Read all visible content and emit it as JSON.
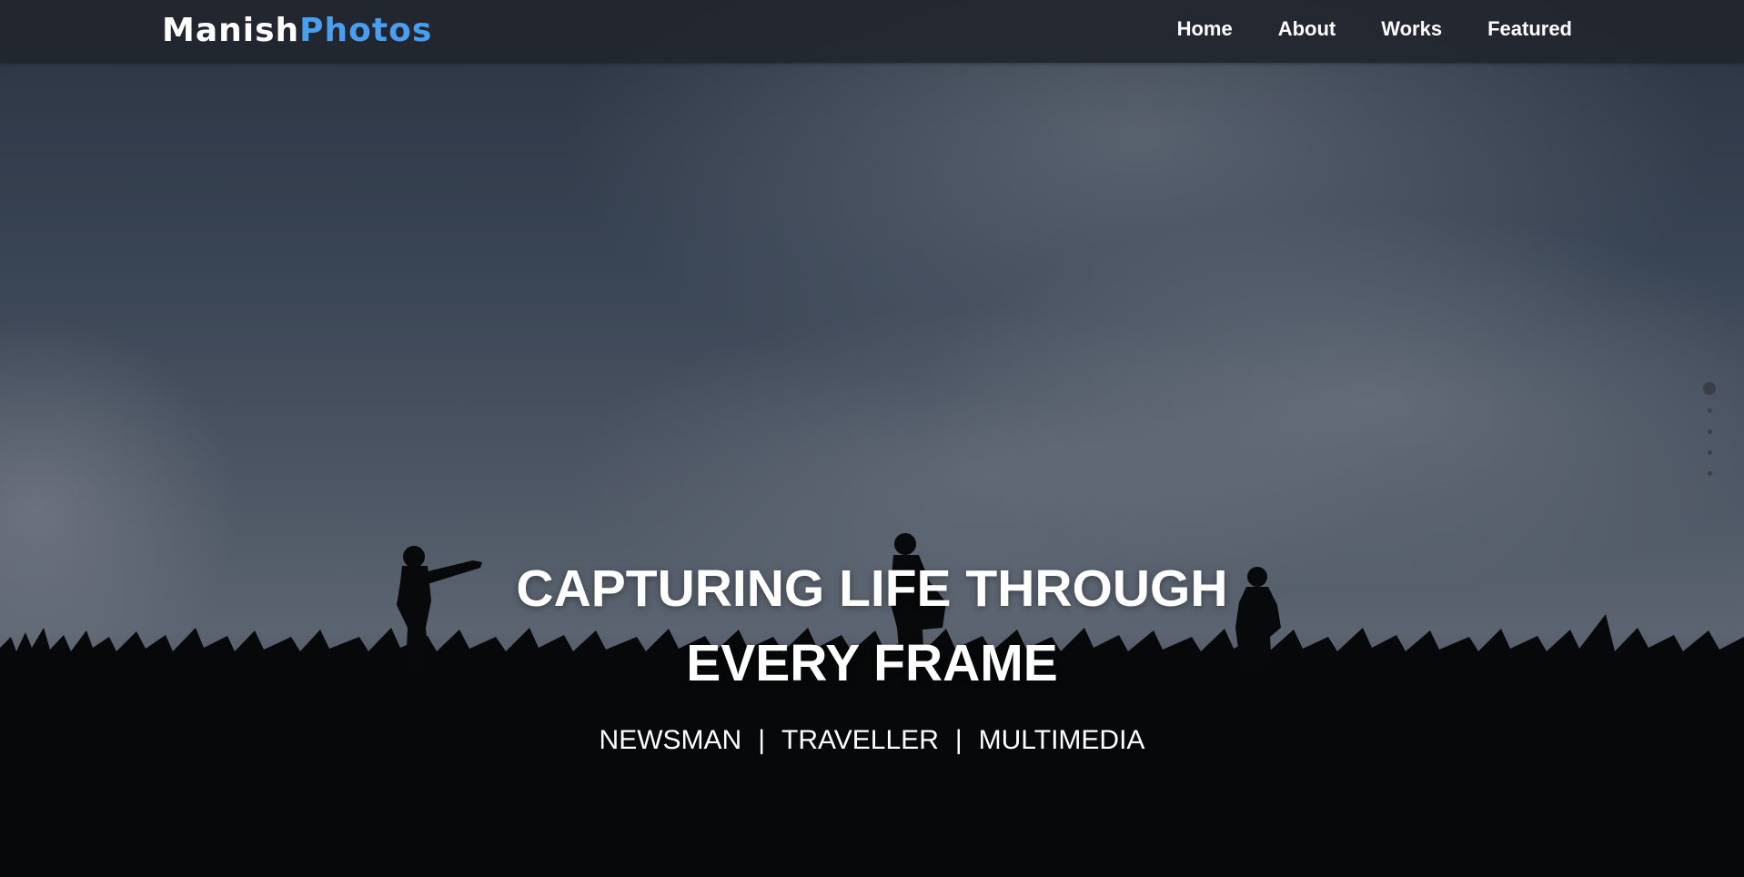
{
  "brand": {
    "part1": "Manish",
    "part2": "Photos",
    "accent_color": "#4a9ef0"
  },
  "nav": {
    "items": [
      {
        "label": "Home"
      },
      {
        "label": "About"
      },
      {
        "label": "Works"
      },
      {
        "label": "Featured"
      }
    ]
  },
  "hero": {
    "headline_line1": "CAPTURING LIFE THROUGH",
    "headline_line2": "EVERY FRAME",
    "tagline": {
      "item1": "NEWSMAN",
      "separator": "|",
      "item2": "TRAVELLER",
      "item3": "MULTIMEDIA"
    }
  },
  "slider": {
    "dot_count": 5,
    "active_index": 0
  }
}
